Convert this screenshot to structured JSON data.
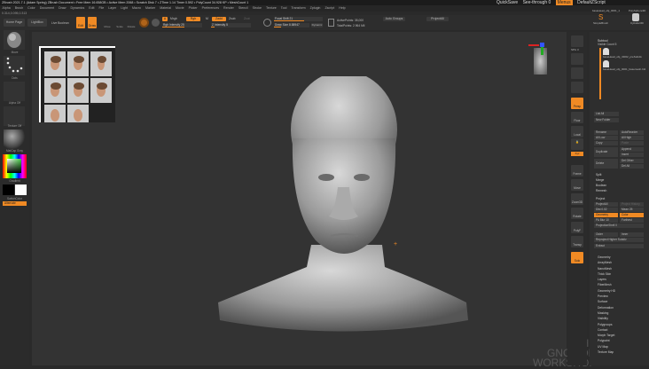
{
  "title": "ZBrush 2021.7.1 (Adam Spring)  ZBrush Document   • Free Mem 16.658GB • Active Mem 2068 • Scratch Disk 7 • ZTime 1.14 Timer 0.592 • PolyCount 34.928 KP • MeshCount 1",
  "menu": [
    "Alpha",
    "Brush",
    "Color",
    "Document",
    "Draw",
    "Dynamics",
    "Edit",
    "File",
    "Layer",
    "Light",
    "Macro",
    "Marker",
    "Material",
    "Movie",
    "Picker",
    "Preferences",
    "Render",
    "Stencil",
    "Stroke",
    "Texture",
    "Tool",
    "Transform",
    "Zplugin",
    "Zscript",
    "Help"
  ],
  "coords": "0.314,0.095,0.313",
  "topright": {
    "quicksave": "QuickSave",
    "seethrough": "See-through 0",
    "menus": "Menus",
    "script": "DefaultZScript"
  },
  "toolbar": {
    "home": "Home Page",
    "lightbox": "LightBox",
    "liveboolean": "Live Boolean",
    "edit": "Edit",
    "draw": "Draw",
    "move": "Move",
    "scale": "Scale",
    "rotate": "Rotate",
    "a": "A",
    "mrgb": "Mrgb",
    "rgb": "Rgb",
    "m": "M",
    "zadd": "Zadd",
    "zsub": "Zsub",
    "zcut": "Zcut",
    "rgb_intensity": "Rgb Intensity 25",
    "z_intensity": "Z Intensity 5",
    "focal_shift": "Focal Shift 21",
    "draw_size": "Draw Size 8.58947",
    "dynamic": "Dynamic",
    "active_points": "ActivePoints: 35,000",
    "total_points": "TotalPoints: 2.964 Mil",
    "auto_groups": "Auto Groups",
    "project_all": "ProjectAll"
  },
  "leftshelf": {
    "brush": "Move",
    "stroke": "Dots",
    "alpha": "Alpha Off",
    "texture": "Texture Off",
    "material": "MatCap Gray",
    "gradient": "Gradient",
    "switch": "SwitchColor",
    "alternate": "Alternate"
  },
  "rightshelf": {
    "persp": "Persp",
    "floor": "Floor",
    "local": "Local",
    "frame": "Frame",
    "move": "Move",
    "zoom": "Zoom3D",
    "rotate": "Rotate",
    "polyf": "PolyF",
    "transp": "Transp",
    "solo": "Solo",
    "xyz": "Xyz",
    "spix": "SPix 3",
    "dynamic": "Dynamic"
  },
  "panel": {
    "tool_current": "baseHead_obj_0001_1",
    "polysphere": "PolySphere3D",
    "simplebrush": "SimpleBrush",
    "cylinder": "Cylinder3D",
    "subtool": "Subtool",
    "visible_count": "Visible Count 5",
    "subtools": [
      "baseHead_obj_r0002_preSubdiv",
      "baseHead_obj_0001_basemesh-hi2"
    ],
    "list_all": "List All",
    "new_folder": "New Folder",
    "buttons": [
      "Rename",
      "AutoReorder",
      "All Low",
      "All High",
      "Copy",
      "Paste",
      "Duplicate",
      "Append",
      "Insert",
      "Delete",
      "Del Other",
      "Del All"
    ],
    "ops": [
      "Split",
      "Merge",
      "Boolean",
      "Remesh"
    ],
    "project": "Project",
    "projectall": "ProjectAll",
    "project_history": "Project History",
    "dist": "Dist 0.02",
    "mean": "Mean 25",
    "geometry": "Geometry",
    "color": "Color",
    "pa_blur": "PA Blur 10",
    "farthest": "Farthest",
    "projection_shell": "ProjectionShell 0",
    "outer": "Outer",
    "inner": "Inner",
    "reproject": "Reproject Higher Subdiv",
    "extract": "Extract",
    "menus": [
      "Geometry",
      "ArrayMesh",
      "NanoMesh",
      "Thick Skin",
      "Layers",
      "FiberMesh",
      "Geometry HD",
      "Preview",
      "Surface",
      "Deformation",
      "Masking",
      "Visibility",
      "Polygroups",
      "Contact",
      "Morph Target",
      "Polypaint",
      "UV Map",
      "Texture Map"
    ]
  },
  "watermark": [
    "THE GNOMON",
    "WORKSHOP"
  ],
  "colors": {
    "accent": "#f08a24",
    "bg": "#2a2a2a"
  }
}
